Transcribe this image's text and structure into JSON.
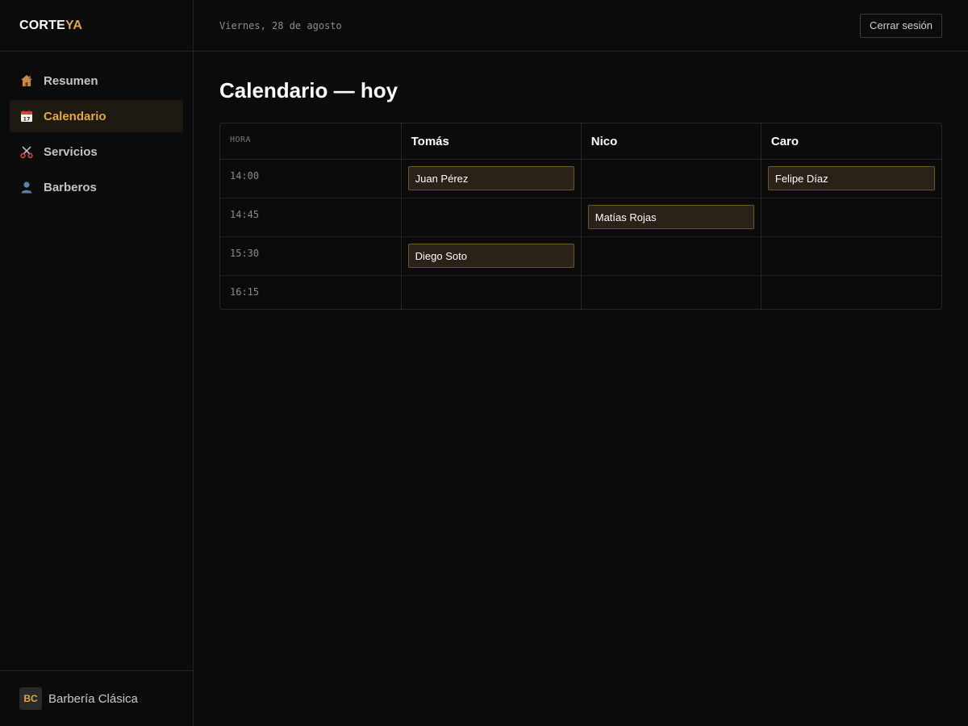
{
  "brand": {
    "part1": "CORTE",
    "part2": "YA",
    "accent_color": "#e3a744"
  },
  "sidebar": {
    "items": [
      {
        "label": "Resumen",
        "icon": "house-icon",
        "active": false
      },
      {
        "label": "Calendario",
        "icon": "calendar-icon",
        "active": true
      },
      {
        "label": "Servicios",
        "icon": "scissors-icon",
        "active": false
      },
      {
        "label": "Barberos",
        "icon": "user-icon",
        "active": false
      }
    ],
    "footer": {
      "initials": "BC",
      "name": "Barbería Clásica"
    }
  },
  "topbar": {
    "date": "Viernes, 28 de agosto",
    "logout_label": "Cerrar sesión"
  },
  "page": {
    "title": "Calendario — hoy"
  },
  "calendar": {
    "time_header": "HORA",
    "barbers": [
      "Tomás",
      "Nico",
      "Caro"
    ],
    "slots": [
      {
        "time": "14:00",
        "appointments": [
          "Juan Pérez",
          "",
          "Felipe Díaz"
        ]
      },
      {
        "time": "14:45",
        "appointments": [
          "",
          "Matías Rojas",
          ""
        ]
      },
      {
        "time": "15:30",
        "appointments": [
          "Diego Soto",
          "",
          ""
        ]
      },
      {
        "time": "16:15",
        "appointments": [
          "",
          "",
          ""
        ]
      }
    ]
  }
}
